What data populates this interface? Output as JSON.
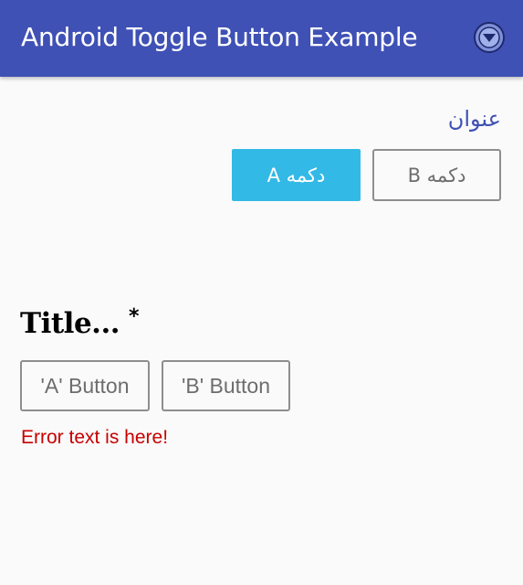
{
  "appbar": {
    "title": "Android Toggle Button Example",
    "menu_icon": "chevron-down-circle-icon",
    "color": "#3f51b5"
  },
  "rtl_group": {
    "title": "عنوان",
    "button_a": "دکمه A",
    "button_b": "دکمه B",
    "selected": "button_a",
    "selected_color": "#33b9e6"
  },
  "ltr_group": {
    "title": "Title...",
    "required_mark": "*",
    "button_a": "'A' Button",
    "button_b": "'B' Button"
  },
  "error": {
    "text": "Error text is here!",
    "color": "#c80000"
  }
}
